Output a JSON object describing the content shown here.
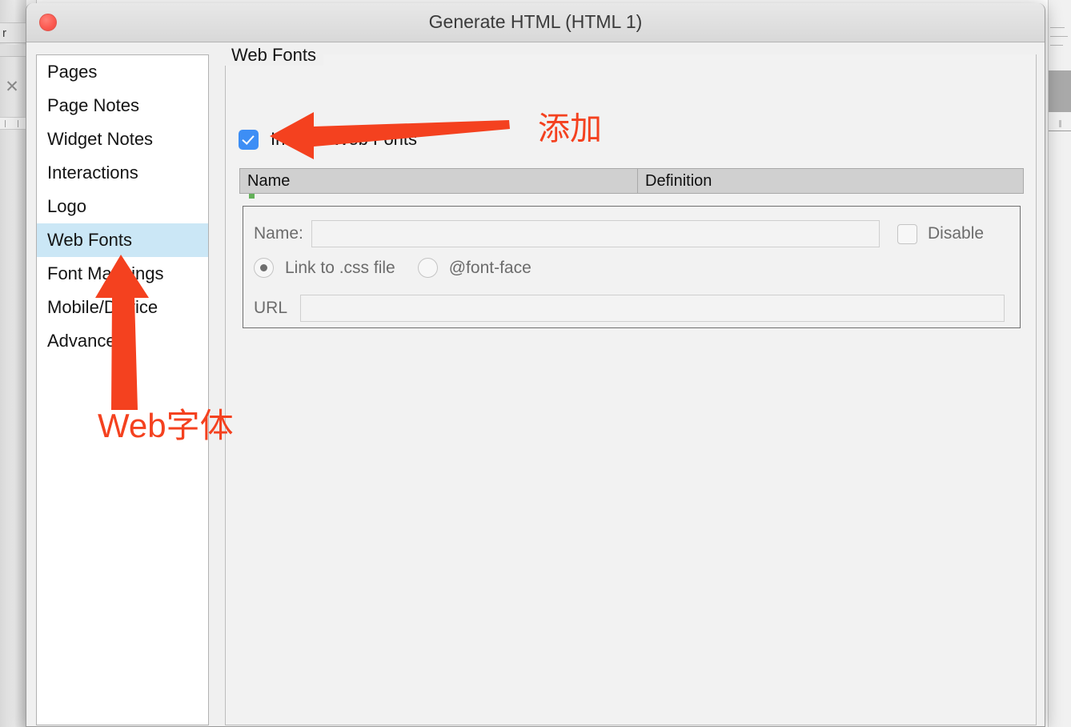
{
  "background": {
    "tab_label": "r",
    "close_icon": "close-x-icon"
  },
  "dialog": {
    "title": "Generate HTML (HTML 1)",
    "close_button_icon": "close-dot-icon"
  },
  "sidebar": {
    "items": [
      {
        "label": "Pages",
        "selected": false
      },
      {
        "label": "Page Notes",
        "selected": false
      },
      {
        "label": "Widget Notes",
        "selected": false
      },
      {
        "label": "Interactions",
        "selected": false
      },
      {
        "label": "Logo",
        "selected": false
      },
      {
        "label": "Web Fonts",
        "selected": true
      },
      {
        "label": "Font Mappings",
        "selected": false
      },
      {
        "label": "Mobile/Device",
        "selected": false
      },
      {
        "label": "Advanced",
        "selected": false
      }
    ]
  },
  "panel": {
    "group_title": "Web Fonts",
    "include_checkbox": {
      "label": "Include Web Fonts",
      "checked": true
    },
    "add_button_icon": "plus-icon",
    "table": {
      "columns": [
        "Name",
        "Definition"
      ],
      "rows": []
    },
    "detail": {
      "name_label": "Name:",
      "name_value": "",
      "disable_label": "Disable",
      "disable_checked": false,
      "radio_options": [
        {
          "label": "Link to .css file",
          "selected": true
        },
        {
          "label": "@font-face",
          "selected": false
        }
      ],
      "url_label": "URL",
      "url_value": ""
    }
  },
  "annotations": {
    "color": "#f4411f",
    "add_text": "添加",
    "webfont_text": "Web字体",
    "arrow_horizontal": "left-arrow-annotation",
    "arrow_vertical": "up-arrow-annotation"
  }
}
